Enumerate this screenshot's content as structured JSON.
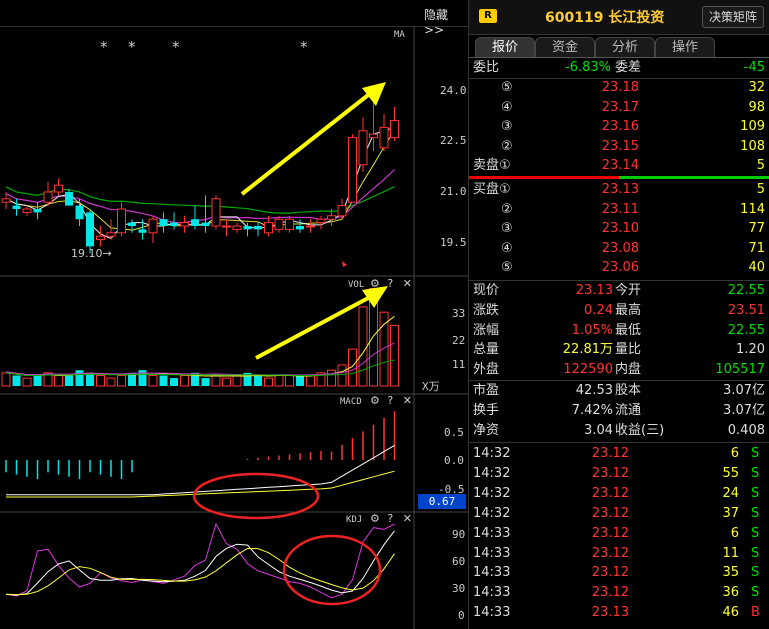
{
  "toolbar": {
    "hide_label": "隐藏>>",
    "decision_label": "决策矩阵"
  },
  "stock": {
    "badge": "R",
    "title": "600119 长江投资"
  },
  "tabs": [
    "报价",
    "资金",
    "分析",
    "操作"
  ],
  "commission": {
    "ratio_label": "委比",
    "ratio_value": "-6.83%",
    "diff_label": "委差",
    "diff_value": "-45"
  },
  "asks": [
    {
      "label": "⑤",
      "price": "23.18",
      "volume": "32"
    },
    {
      "label": "④",
      "price": "23.17",
      "volume": "98"
    },
    {
      "label": "③",
      "price": "23.16",
      "volume": "109"
    },
    {
      "label": "②",
      "price": "23.15",
      "volume": "108"
    },
    {
      "label": "卖盘①",
      "price": "23.14",
      "volume": "5"
    }
  ],
  "bids": [
    {
      "label": "买盘①",
      "price": "23.13",
      "volume": "5"
    },
    {
      "label": "②",
      "price": "23.11",
      "volume": "114"
    },
    {
      "label": "③",
      "price": "23.10",
      "volume": "77"
    },
    {
      "label": "④",
      "price": "23.08",
      "volume": "71"
    },
    {
      "label": "⑤",
      "price": "23.06",
      "volume": "40"
    }
  ],
  "quote": [
    {
      "l1": "现价",
      "v1": "23.13",
      "c1": "red",
      "l2": "今开",
      "v2": "22.55",
      "c2": "green"
    },
    {
      "l1": "涨跌",
      "v1": "0.24",
      "c1": "red",
      "l2": "最高",
      "v2": "23.51",
      "c2": "red"
    },
    {
      "l1": "涨幅",
      "v1": "1.05%",
      "c1": "red",
      "l2": "最低",
      "v2": "22.55",
      "c2": "green"
    },
    {
      "l1": "总量",
      "v1": "22.81万",
      "c1": "yellow",
      "l2": "量比",
      "v2": "1.20",
      "c2": "white"
    },
    {
      "l1": "外盘",
      "v1": "122590",
      "c1": "red",
      "l2": "内盘",
      "v2": "105517",
      "c2": "green"
    }
  ],
  "fundamentals": [
    {
      "l1": "市盈",
      "v1": "42.53",
      "l2": "股本",
      "v2": "3.07亿"
    },
    {
      "l1": "换手",
      "v1": "7.42%",
      "l2": "流通",
      "v2": "3.07亿"
    },
    {
      "l1": "净资",
      "v1": "3.04",
      "l2": "收益(三)",
      "v2": "0.408"
    }
  ],
  "ticks": [
    {
      "time": "14:32",
      "price": "23.12",
      "vol": "6",
      "side": "S"
    },
    {
      "time": "14:32",
      "price": "23.12",
      "vol": "55",
      "side": "S"
    },
    {
      "time": "14:32",
      "price": "23.12",
      "vol": "24",
      "side": "S"
    },
    {
      "time": "14:32",
      "price": "23.12",
      "vol": "37",
      "side": "S"
    },
    {
      "time": "14:33",
      "price": "23.12",
      "vol": "6",
      "side": "S"
    },
    {
      "time": "14:33",
      "price": "23.12",
      "vol": "11",
      "side": "S"
    },
    {
      "time": "14:33",
      "price": "23.12",
      "vol": "35",
      "side": "S"
    },
    {
      "time": "14:33",
      "price": "23.12",
      "vol": "36",
      "side": "S"
    },
    {
      "time": "14:33",
      "price": "23.13",
      "vol": "46",
      "side": "B"
    }
  ],
  "chart_data": [
    {
      "type": "candlestick",
      "indicator": "MA",
      "y_ticks": [
        "24.0",
        "22.5",
        "21.0",
        "19.5"
      ],
      "annotation": "19.10",
      "markers": [
        "*",
        "*",
        "*",
        "*"
      ],
      "candles": [
        [
          20.7,
          20.8,
          20.5,
          21.0
        ],
        [
          20.6,
          20.5,
          20.3,
          20.8
        ],
        [
          20.4,
          20.5,
          20.3,
          20.6
        ],
        [
          20.5,
          20.4,
          20.2,
          20.7
        ],
        [
          20.7,
          21.0,
          20.6,
          21.3
        ],
        [
          21.0,
          21.2,
          20.9,
          21.4
        ],
        [
          21.0,
          20.6,
          20.6,
          21.1
        ],
        [
          20.6,
          20.2,
          20.0,
          20.8
        ],
        [
          20.4,
          19.4,
          19.2,
          20.5
        ],
        [
          19.6,
          19.7,
          19.4,
          20.0
        ],
        [
          19.7,
          19.8,
          19.6,
          20.2
        ],
        [
          19.8,
          20.5,
          19.7,
          20.7
        ],
        [
          20.1,
          20.0,
          19.8,
          20.2
        ],
        [
          19.9,
          19.8,
          19.6,
          20.2
        ],
        [
          19.8,
          20.2,
          19.5,
          20.3
        ],
        [
          20.2,
          20.0,
          19.8,
          20.4
        ],
        [
          20.1,
          20.0,
          19.9,
          20.4
        ],
        [
          20.0,
          20.1,
          19.8,
          20.3
        ],
        [
          20.2,
          20.0,
          19.9,
          20.6
        ],
        [
          20.1,
          20.0,
          19.8,
          20.9
        ],
        [
          20.0,
          20.8,
          19.9,
          20.9
        ],
        [
          20.0,
          20.0,
          19.7,
          20.2
        ],
        [
          19.9,
          20.0,
          19.8,
          20.1
        ],
        [
          20.0,
          19.9,
          19.7,
          20.1
        ],
        [
          20.0,
          19.9,
          19.7,
          20.1
        ],
        [
          19.8,
          20.1,
          19.7,
          20.3
        ],
        [
          19.9,
          20.2,
          19.8,
          20.3
        ],
        [
          19.9,
          20.2,
          19.8,
          20.3
        ],
        [
          20.0,
          19.9,
          19.8,
          20.2
        ],
        [
          20.0,
          20.0,
          19.8,
          20.2
        ],
        [
          20.1,
          20.2,
          19.9,
          20.3
        ],
        [
          20.2,
          20.3,
          20.0,
          20.5
        ],
        [
          20.3,
          20.6,
          20.2,
          20.8
        ],
        [
          20.7,
          22.6,
          20.7,
          22.7
        ],
        [
          21.8,
          22.8,
          21.6,
          23.2
        ],
        [
          22.6,
          22.7,
          22.2,
          24.0
        ],
        [
          22.3,
          22.9,
          22.2,
          23.3
        ],
        [
          22.6,
          23.1,
          22.5,
          23.5
        ]
      ]
    },
    {
      "type": "bar",
      "indicator": "VOL",
      "y_ticks": [
        "33",
        "22",
        "11"
      ],
      "unit": "X万",
      "values": [
        5,
        4,
        3,
        4,
        5,
        4,
        4,
        6,
        5,
        4,
        3,
        4,
        5,
        6,
        4,
        4,
        3,
        4,
        5,
        3,
        4,
        3,
        4,
        5,
        4,
        3,
        4,
        4,
        4,
        4,
        5,
        6,
        8,
        14,
        30,
        37,
        28,
        23,
        17
      ]
    },
    {
      "type": "line",
      "indicator": "MACD",
      "y_ticks": [
        "0.5",
        "0.0",
        "-0.5"
      ],
      "value_badge": "0.67"
    },
    {
      "type": "line",
      "indicator": "KDJ",
      "y_ticks": [
        "90",
        "60",
        "30",
        "0"
      ]
    }
  ]
}
